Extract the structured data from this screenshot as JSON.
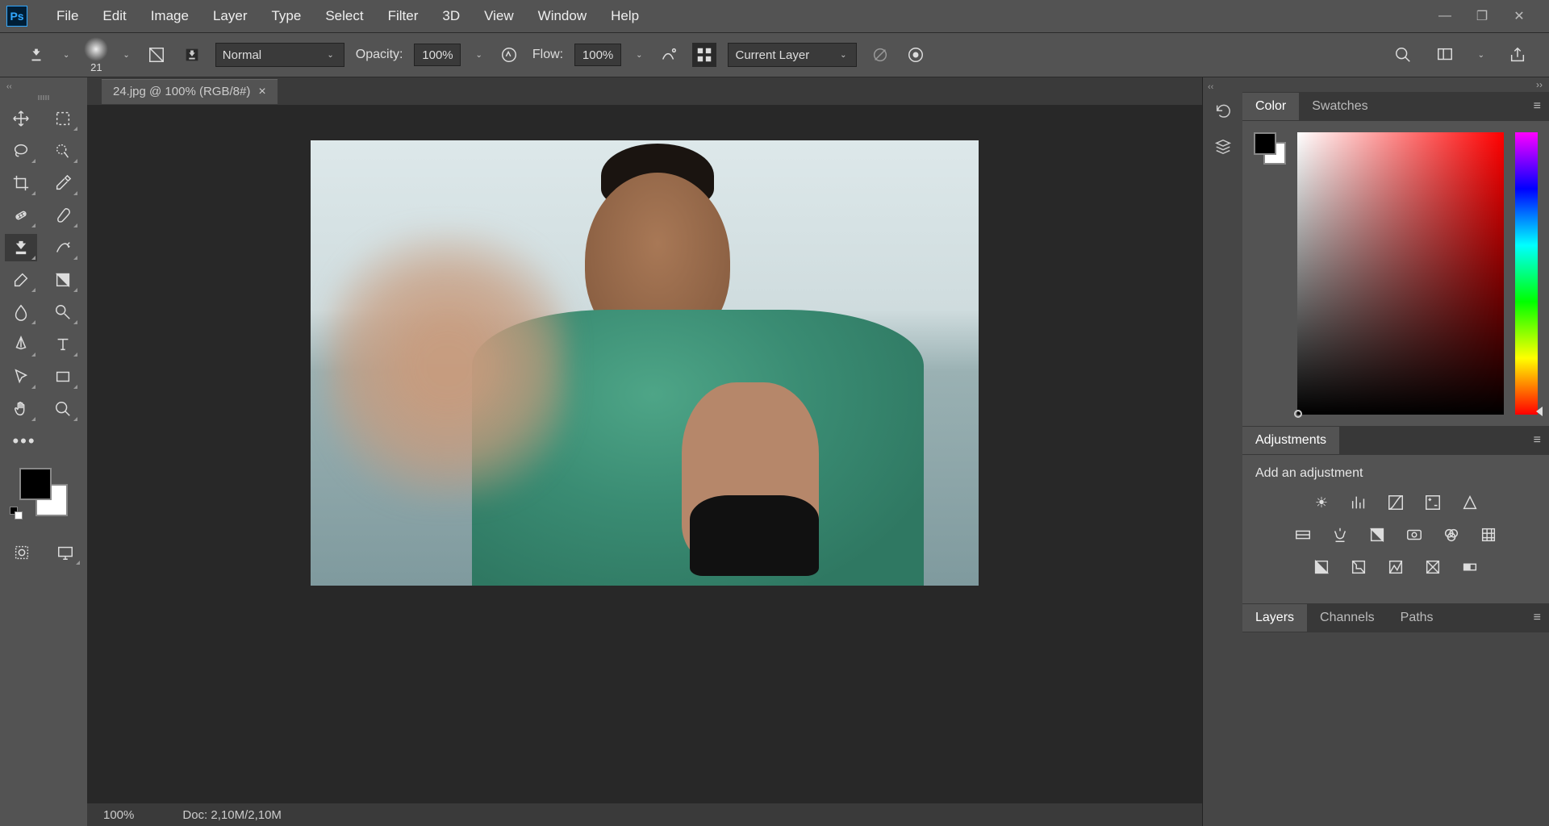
{
  "app": {
    "logo": "Ps"
  },
  "menu": [
    "File",
    "Edit",
    "Image",
    "Layer",
    "Type",
    "Select",
    "Filter",
    "3D",
    "View",
    "Window",
    "Help"
  ],
  "options": {
    "brush_size": "21",
    "mode_label": "Normal",
    "opacity_label": "Opacity:",
    "opacity_value": "100%",
    "flow_label": "Flow:",
    "flow_value": "100%",
    "sample_label": "Current Layer"
  },
  "document": {
    "tab_title": "24.jpg @ 100% (RGB/8#)",
    "zoom": "100%",
    "doc_info": "Doc: 2,10M/2,10M"
  },
  "panels": {
    "color_tab": "Color",
    "swatches_tab": "Swatches",
    "adjustments_tab": "Adjustments",
    "adjustments_title": "Add an adjustment",
    "layers_tab": "Layers",
    "channels_tab": "Channels",
    "paths_tab": "Paths"
  }
}
